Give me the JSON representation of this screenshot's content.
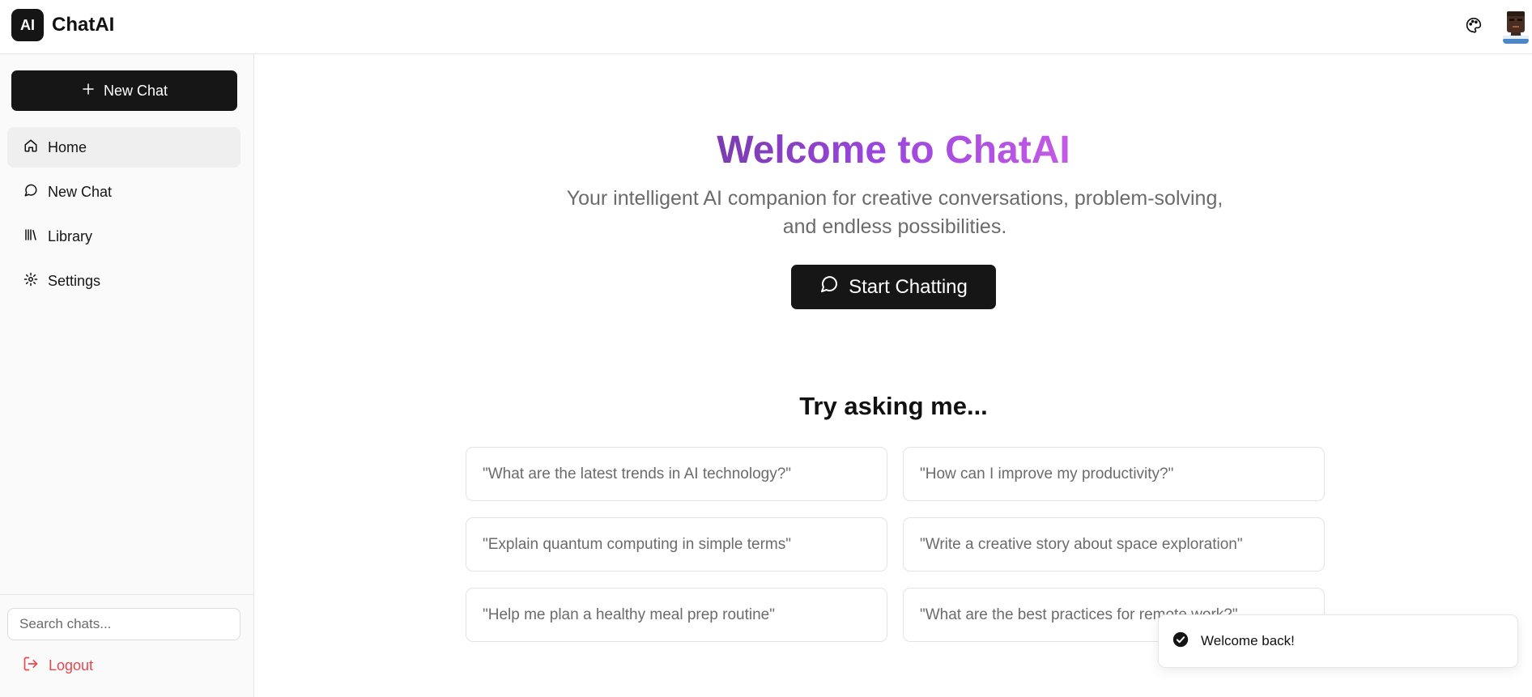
{
  "header": {
    "logo_text": "AI",
    "app_title": "ChatAI",
    "icons": {
      "theme": "palette-icon",
      "user": "avatar"
    }
  },
  "sidebar": {
    "new_chat_label": "New Chat",
    "items": [
      {
        "label": "Home",
        "icon": "home-icon",
        "active": true
      },
      {
        "label": "New Chat",
        "icon": "message-circle-icon",
        "active": false
      },
      {
        "label": "Library",
        "icon": "library-icon",
        "active": false
      },
      {
        "label": "Settings",
        "icon": "gear-icon",
        "active": false
      }
    ],
    "search_placeholder": "Search chats...",
    "logout_label": "Logout"
  },
  "main": {
    "title": "Welcome to ChatAI",
    "subtitle": "Your intelligent AI companion for creative conversations, problem-solving, and endless possibilities.",
    "start_label": "Start Chatting",
    "try_title": "Try asking me...",
    "suggestions": [
      "\"What are the latest trends in AI technology?\"",
      "\"How can I improve my productivity?\"",
      "\"Explain quantum computing in simple terms\"",
      "\"Write a creative story about space exploration\"",
      "\"Help me plan a healthy meal prep routine\"",
      "\"What are the best practices for remote work?\""
    ]
  },
  "toast": {
    "message": "Welcome back!"
  },
  "colors": {
    "primary_button": "#161616",
    "gradient_start": "#7a3cb0",
    "gradient_end": "#c35be6",
    "logout": "#e5484d",
    "muted_text": "#6b6b6b"
  }
}
